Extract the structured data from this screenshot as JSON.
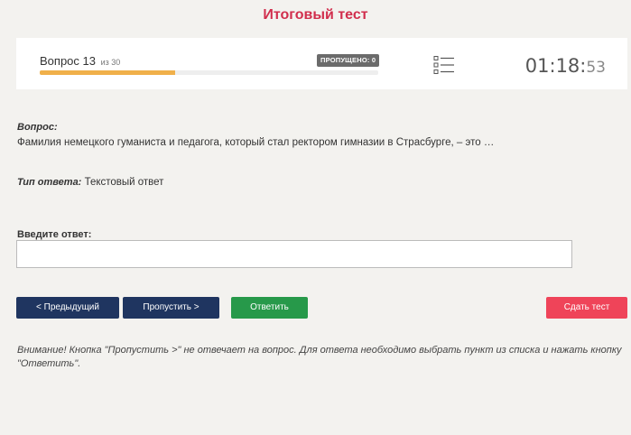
{
  "page": {
    "title": "Итоговый тест"
  },
  "header": {
    "question_label": "Вопрос 13",
    "question_total": "из 30",
    "skipped_badge": "ПРОПУЩЕНО: 0",
    "progress_fraction": 0.4,
    "timer_main": "01:18:",
    "timer_seconds": "53",
    "list_icon": "list-icon"
  },
  "question": {
    "label": "Вопрос:",
    "text": "Фамилия немецкого гуманиста и педагога, который стал ректором гимназии в Страсбурге, – это …"
  },
  "answer_type": {
    "label": "Тип ответа:",
    "value": "Текстовый ответ"
  },
  "answer": {
    "label": "Введите ответ:",
    "value": "",
    "placeholder": ""
  },
  "buttons": {
    "prev": "< Предыдущий",
    "skip": "Пропустить >",
    "answer": "Ответить",
    "submit": "Сдать тест"
  },
  "colors": {
    "title": "#d12e4d",
    "nav_buttons": "#1f3560",
    "answer_button": "#27994a",
    "submit_button": "#ef4459",
    "progress": "#f0b04a"
  },
  "notice": "Внимание! Кнопка \"Пропустить >\" не отвечает на вопрос. Для ответа необходимо выбрать пункт из списка и нажать кнопку \"Ответить\"."
}
